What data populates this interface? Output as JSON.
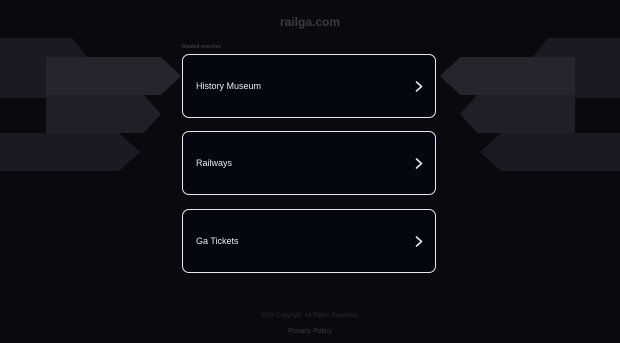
{
  "site": {
    "title": "railga.com"
  },
  "searches": {
    "section_label": "Related searches",
    "items": [
      {
        "label": "History Museum"
      },
      {
        "label": "Railways"
      },
      {
        "label": "Ga Tickets"
      }
    ]
  },
  "footer": {
    "copyright": "2024 Copyright. All Rights Reserved.",
    "privacy_link": "Privacy Policy"
  },
  "colors": {
    "background": "#0a0a0e",
    "card_background": "#040610",
    "card_border": "#e8e8ee",
    "text": "#e8e8ee"
  },
  "icons": {
    "card_arrow": "chevron-right-icon"
  }
}
